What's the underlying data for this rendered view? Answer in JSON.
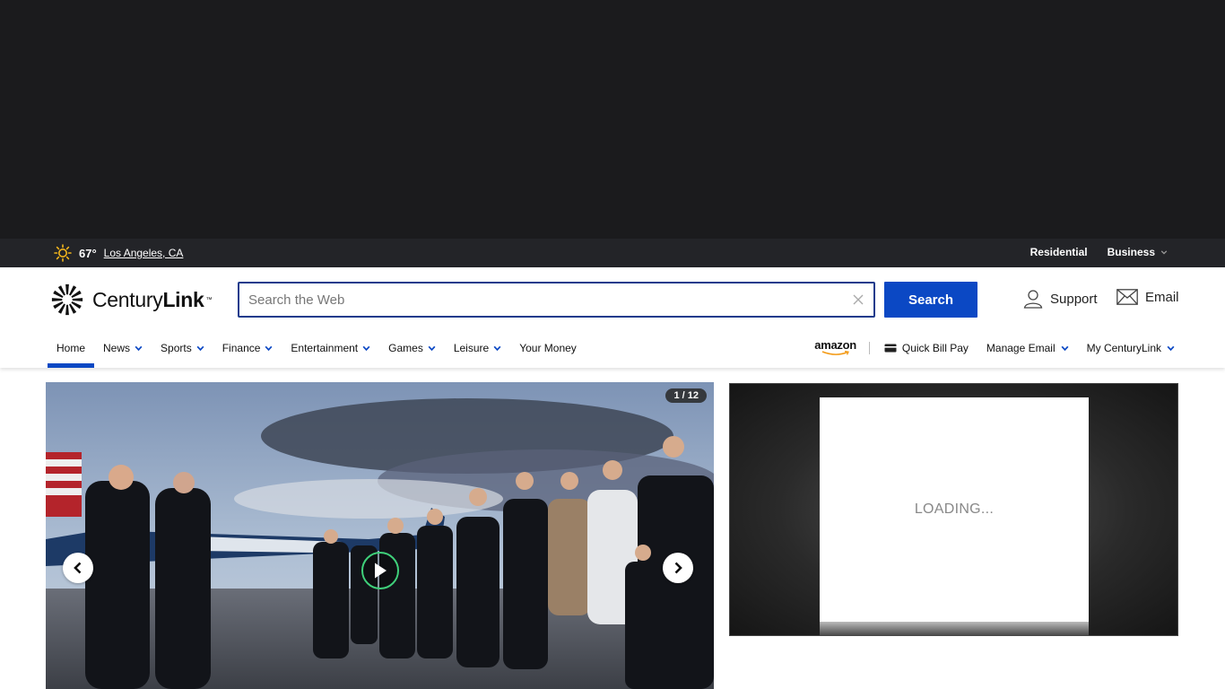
{
  "weather": {
    "icon": "sun-icon",
    "temperature": "67°",
    "location": "Los Angeles, CA"
  },
  "utility_links": {
    "residential": "Residential",
    "business": "Business"
  },
  "brand": {
    "name_regular": "Century",
    "name_bold": "Link",
    "trademark": "™",
    "logo_mark_trademark": "™"
  },
  "search": {
    "placeholder": "Search the Web",
    "value": "",
    "button_label": "Search"
  },
  "account_links": {
    "support": "Support",
    "email": "Email"
  },
  "nav": {
    "items": [
      {
        "label": "Home",
        "dropdown": false,
        "active": true
      },
      {
        "label": "News",
        "dropdown": true
      },
      {
        "label": "Sports",
        "dropdown": true
      },
      {
        "label": "Finance",
        "dropdown": true
      },
      {
        "label": "Entertainment",
        "dropdown": true
      },
      {
        "label": "Games",
        "dropdown": true
      },
      {
        "label": "Leisure",
        "dropdown": true
      },
      {
        "label": "Your Money",
        "dropdown": false
      }
    ],
    "amazon": "amazon",
    "quick_bill_pay": "Quick Bill Pay",
    "manage_email": "Manage Email",
    "my_centurylink": "My CenturyLink"
  },
  "slideshow": {
    "counter": "1 / 12",
    "progress": {
      "current": 1,
      "total": 12
    }
  },
  "side_ad": {
    "loading_text": "LOADING..."
  },
  "colors": {
    "brand_blue": "#0b48c4",
    "search_border": "#1a3b8c",
    "utility_bar": "#232428",
    "top_ad": "#1b1b1d",
    "play_ring": "#3fd07a"
  }
}
